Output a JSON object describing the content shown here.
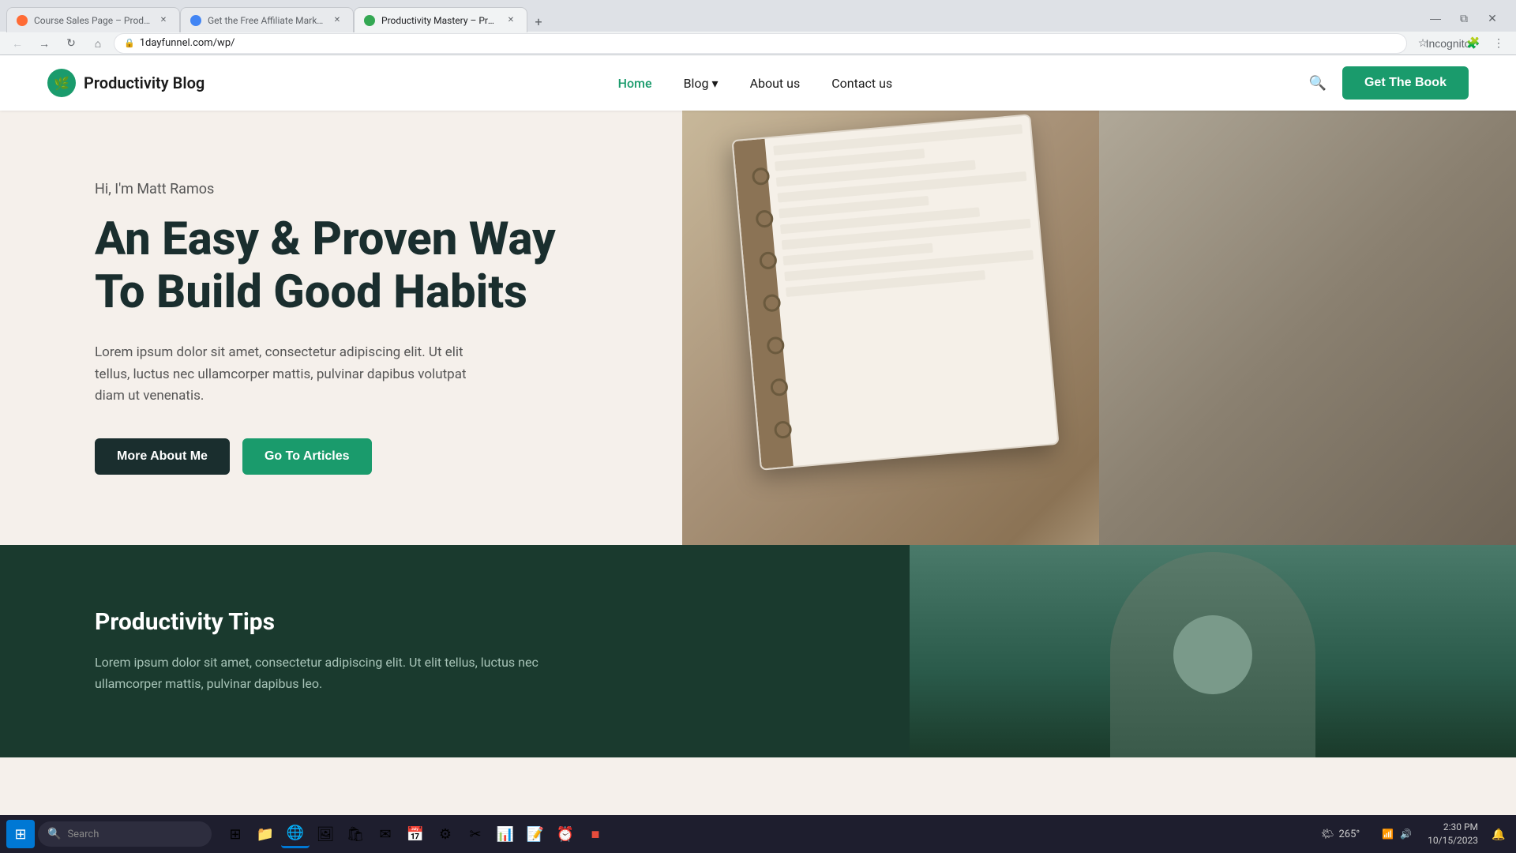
{
  "browser": {
    "tabs": [
      {
        "id": "tab1",
        "title": "Course Sales Page – Productivit...",
        "icon_color": "orange",
        "active": false
      },
      {
        "id": "tab2",
        "title": "Get the Free Affiliate Marketing",
        "icon_color": "blue",
        "active": false
      },
      {
        "id": "tab3",
        "title": "Productivity Mastery – Productivit...",
        "icon_color": "green",
        "active": true
      }
    ],
    "address": "1dayfunnel.com/wp/",
    "incognito_label": "Incognito"
  },
  "nav": {
    "logo_text": "Productivity Blog",
    "links": [
      {
        "label": "Home",
        "active": true
      },
      {
        "label": "Blog",
        "dropdown": true
      },
      {
        "label": "About us",
        "active": false
      },
      {
        "label": "Contact us",
        "active": false
      }
    ],
    "cta_label": "Get The Book"
  },
  "hero": {
    "greeting": "Hi, I'm Matt Ramos",
    "title": "An Easy & Proven Way To Build Good Habits",
    "description": "Lorem ipsum dolor sit amet, consectetur adipiscing elit. Ut elit tellus, luctus nec ullamcorper mattis, pulvinar dapibus volutpat diam ut venenatis.",
    "btn_primary": "More About Me",
    "btn_secondary": "Go To Articles"
  },
  "dark_section": {
    "subtitle": "Productivity Tips",
    "description": "Lorem ipsum dolor sit amet, consectetur adipiscing elit. Ut elit tellus, luctus nec ullamcorper mattis, pulvinar dapibus leo."
  },
  "taskbar": {
    "search_placeholder": "Search",
    "weather_temp": "265°",
    "clock_time": "2:30 PM",
    "clock_date": "10/15/2023",
    "apps": [
      {
        "name": "task-view",
        "icon": "⊞"
      },
      {
        "name": "file-explorer",
        "icon": "📁"
      },
      {
        "name": "chrome",
        "icon": "🌐"
      },
      {
        "name": "photos",
        "icon": "🖼"
      },
      {
        "name": "store",
        "icon": "🛍"
      },
      {
        "name": "mail",
        "icon": "✉"
      },
      {
        "name": "calendar",
        "icon": "📅"
      },
      {
        "name": "settings",
        "icon": "⚙"
      }
    ]
  }
}
